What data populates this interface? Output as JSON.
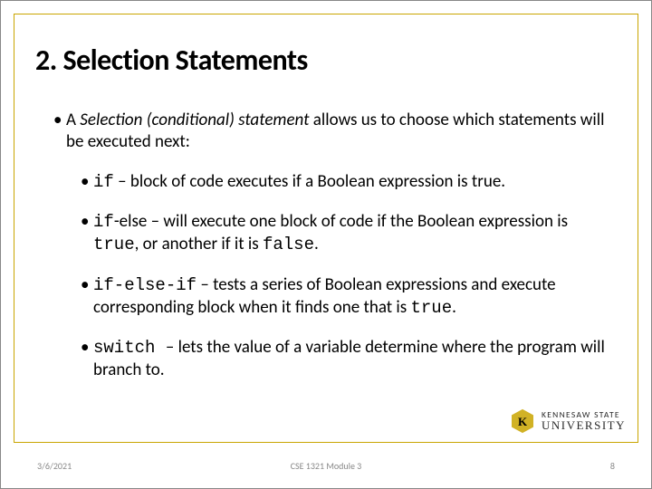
{
  "title": "2.  Selection Statements",
  "intro": {
    "bullet": "•",
    "prefix": "A ",
    "em": "Selection (conditional) statement",
    "rest": " allows us to choose which statements will be executed next:"
  },
  "items": [
    {
      "bullet": "•",
      "code": "if",
      "dash": " – ",
      "rest": "block of code executes if a Boolean expression is true."
    },
    {
      "bullet": "•",
      "code": "if",
      "mid1": "-else – will execute one block of code if the Boolean expression is ",
      "code2": "true",
      "mid2": ", or another if it is ",
      "code3": "false",
      "end": "."
    },
    {
      "bullet": "•",
      "code": "if-else-if",
      "dash": " – ",
      "rest1": "tests a series of Boolean expressions and execute corresponding block when it finds one that is ",
      "code2": "true",
      "end": "."
    },
    {
      "bullet": "•",
      "code": "switch ",
      "dash": " – ",
      "rest": "lets the value of a variable determine where the program will branch to."
    }
  ],
  "footer": {
    "date": "3/6/2021",
    "center": "CSE 1321 Module 3",
    "page": "8"
  },
  "logo": {
    "top": "KENNESAW STATE",
    "bottom": "UNIVERSITY"
  }
}
